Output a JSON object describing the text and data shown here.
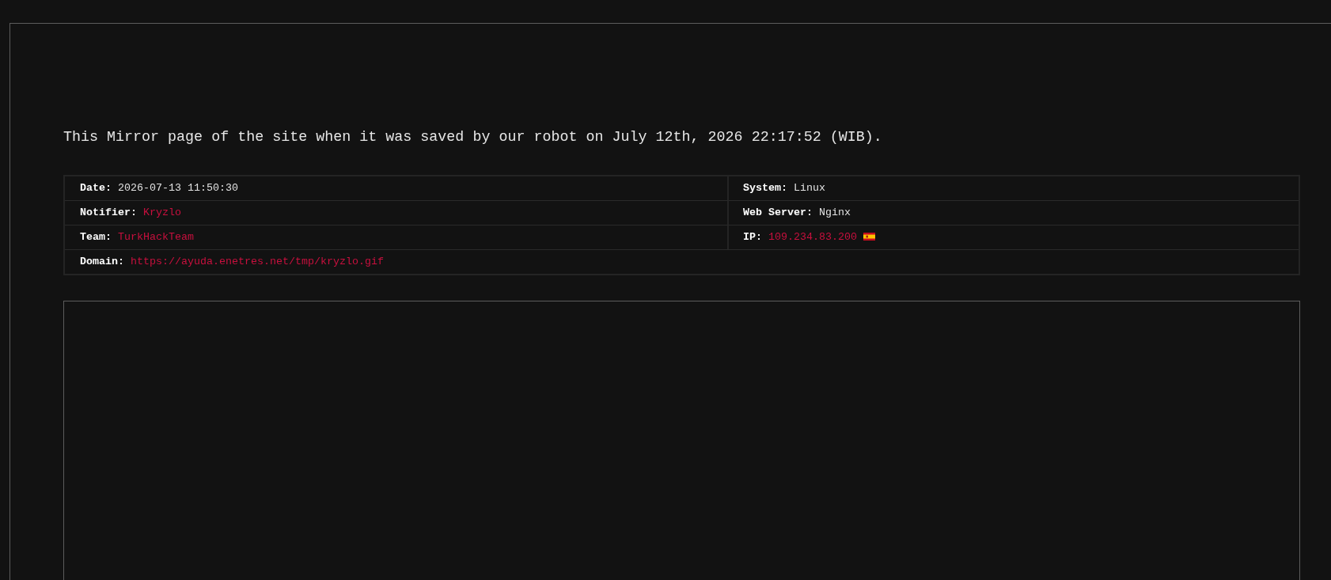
{
  "notice": "This Mirror page of the site when it was saved by our robot on July 12th, 2026 22:17:52 (WIB).",
  "details": {
    "rows": [
      {
        "cells": [
          {
            "label": "Date:",
            "value": "2026-07-13 11:50:30",
            "kind": "text"
          },
          {
            "label": "System:",
            "value": "Linux",
            "kind": "text"
          }
        ]
      },
      {
        "cells": [
          {
            "label": "Notifier:",
            "value": "Kryzlo",
            "kind": "link"
          },
          {
            "label": "Web Server:",
            "value": "Nginx",
            "kind": "text"
          }
        ]
      },
      {
        "cells": [
          {
            "label": "Team:",
            "value": "TurkHackTeam",
            "kind": "link"
          },
          {
            "label": "IP:",
            "value": "109.234.83.200",
            "kind": "flagged"
          }
        ]
      },
      {
        "cells": [
          {
            "label": "Domain:",
            "value": "https://ayuda.enetres.net/tmp/kryzlo.gif",
            "kind": "link"
          }
        ]
      }
    ]
  }
}
